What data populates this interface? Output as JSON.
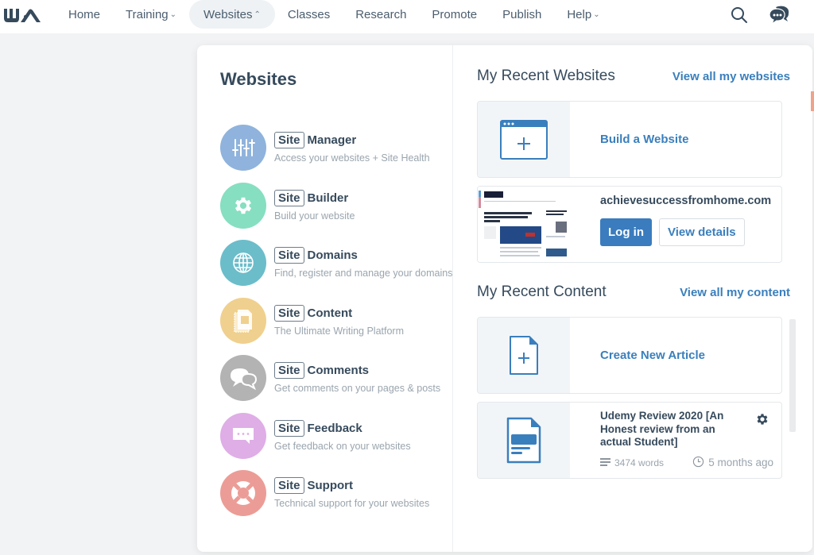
{
  "topbar": {
    "logo_alt": "WA",
    "nav": [
      {
        "label": "Home",
        "caret": ""
      },
      {
        "label": "Training",
        "caret": "⌄"
      },
      {
        "label": "Websites",
        "caret": "⌃",
        "active": true
      },
      {
        "label": "Classes",
        "caret": ""
      },
      {
        "label": "Research",
        "caret": ""
      },
      {
        "label": "Promote",
        "caret": ""
      },
      {
        "label": "Publish",
        "caret": ""
      },
      {
        "label": "Help",
        "caret": "⌄"
      }
    ],
    "icons": [
      "search-icon",
      "chat-icon"
    ]
  },
  "websites_menu": {
    "title": "Websites",
    "badge": "Site",
    "items": [
      {
        "name": "Manager",
        "desc": "Access your websites + Site Health",
        "color": "#8fb3dc",
        "icon": "sliders-icon"
      },
      {
        "name": "Builder",
        "desc": "Build your website",
        "color": "#86dfc0",
        "icon": "gear-icon"
      },
      {
        "name": "Domains",
        "desc": "Find, register and manage your domains",
        "color": "#6bbdca",
        "icon": "globe-icon"
      },
      {
        "name": "Content",
        "desc": "The Ultimate Writing Platform",
        "color": "#f0d08e",
        "icon": "document-icon"
      },
      {
        "name": "Comments",
        "desc": "Get comments on your pages & posts",
        "color": "#b3b3b3",
        "icon": "comments-icon"
      },
      {
        "name": "Feedback",
        "desc": "Get feedback on your websites",
        "color": "#dfaee6",
        "icon": "feedback-icon"
      },
      {
        "name": "Support",
        "desc": "Technical support for your websites",
        "color": "#ec9c96",
        "icon": "lifebuoy-icon"
      }
    ]
  },
  "recent_websites": {
    "title": "My Recent Websites",
    "view_all": "View all my websites",
    "build_label": "Build a Website",
    "site": {
      "domain": "achievesuccessfromhome.com",
      "login_label": "Log in",
      "details_label": "View details"
    }
  },
  "recent_content": {
    "title": "My Recent Content",
    "view_all": "View all my content",
    "create_label": "Create New Article",
    "article": {
      "title": "Udemy Review 2020 [An Honest review from an actual Student]",
      "words": "3474 words",
      "time": "5 months ago"
    }
  },
  "colors": {
    "accent": "#3a7fbd",
    "text_dark": "#364a5c",
    "muted": "#9aa5ae"
  }
}
